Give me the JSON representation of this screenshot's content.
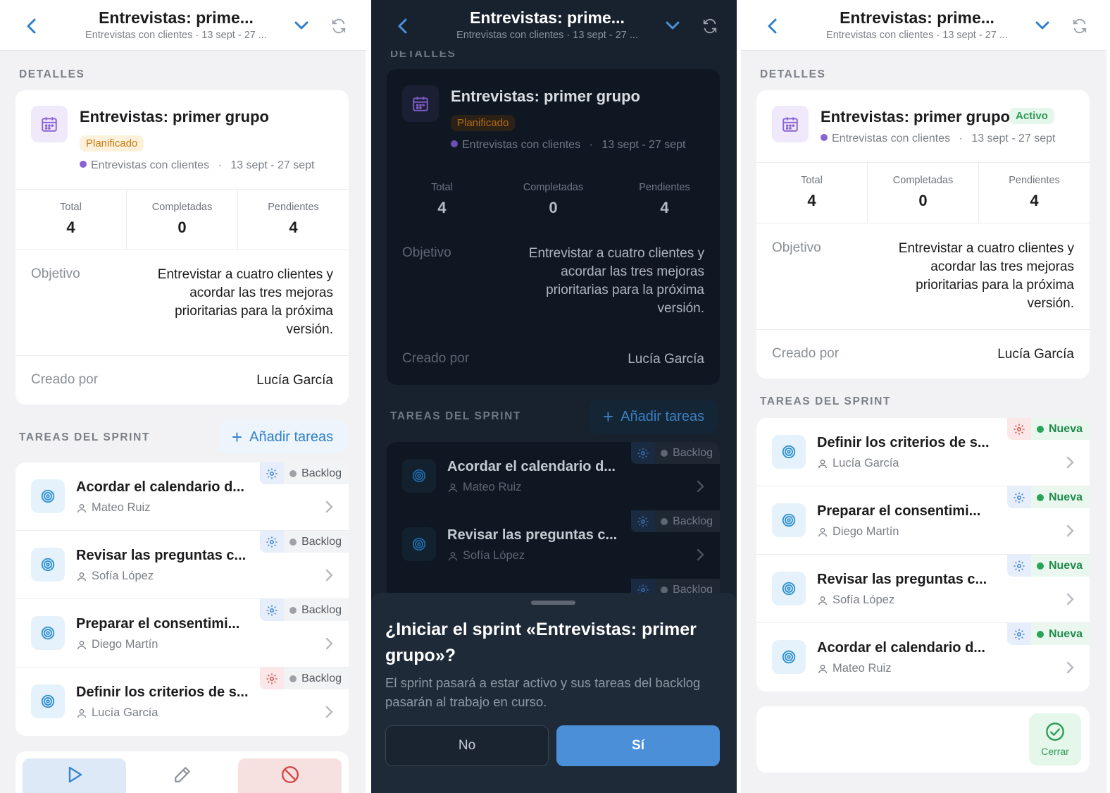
{
  "header": {
    "title": "Entrevistas: prime...",
    "subtitle": "Entrevistas con clientes · 13 sept - 27 ..."
  },
  "details": {
    "section_title": "DETALLES",
    "sprint_title": "Entrevistas: primer grupo",
    "badge_planned": "Planificado",
    "badge_active": "Activo",
    "project": "Entrevistas con clientes",
    "separator": "·",
    "dates": "13 sept - 27 sept",
    "stats": [
      {
        "label": "Total",
        "value": "4"
      },
      {
        "label": "Completadas",
        "value": "0"
      },
      {
        "label": "Pendientes",
        "value": "4"
      }
    ],
    "objective_label": "Objetivo",
    "objective_value": "Entrevistar a cuatro clientes y acordar las tres mejoras prioritarias para la próxima versión.",
    "created_label": "Creado por",
    "created_value": "Lucía García"
  },
  "tasks_section": {
    "title": "TAREAS DEL SPRINT",
    "add_label": "Añadir tareas"
  },
  "tasks_backlog": [
    {
      "name": "Acordar el calendario d...",
      "user": "Mateo Ruiz",
      "status": "Backlog",
      "gear": "blue"
    },
    {
      "name": "Revisar las preguntas c...",
      "user": "Sofía López",
      "status": "Backlog",
      "gear": "blue"
    },
    {
      "name": "Preparar el consentimi...",
      "user": "Diego Martín",
      "status": "Backlog",
      "gear": "blue"
    },
    {
      "name": "Definir los criterios de s...",
      "user": "Lucía García",
      "status": "Backlog",
      "gear": "red"
    }
  ],
  "tasks_active": [
    {
      "name": "Definir los criterios de s...",
      "user": "Lucía García",
      "status": "Nueva",
      "gear": "red"
    },
    {
      "name": "Preparar el consentimi...",
      "user": "Diego Martín",
      "status": "Nueva",
      "gear": "blue"
    },
    {
      "name": "Revisar las preguntas c...",
      "user": "Sofía López",
      "status": "Nueva",
      "gear": "blue"
    },
    {
      "name": "Acordar el calendario d...",
      "user": "Mateo Ruiz",
      "status": "Nueva",
      "gear": "blue"
    }
  ],
  "dark_partial_task_status": "Backlog",
  "modal": {
    "title": "¿Iniciar el sprint «Entrevistas: primer grupo»?",
    "description": "El sprint pasará a estar activo y sus tareas del backlog pasarán al trabajo en curso.",
    "no_label": "No",
    "yes_label": "Sí"
  },
  "close_label": "Cerrar",
  "colors": {
    "accent_blue": "#2f80c9",
    "planned_orange": "#c77a0e",
    "active_green": "#2e9a55",
    "calendar_purple": "#8a63d2",
    "danger_red": "#d24a4a"
  }
}
